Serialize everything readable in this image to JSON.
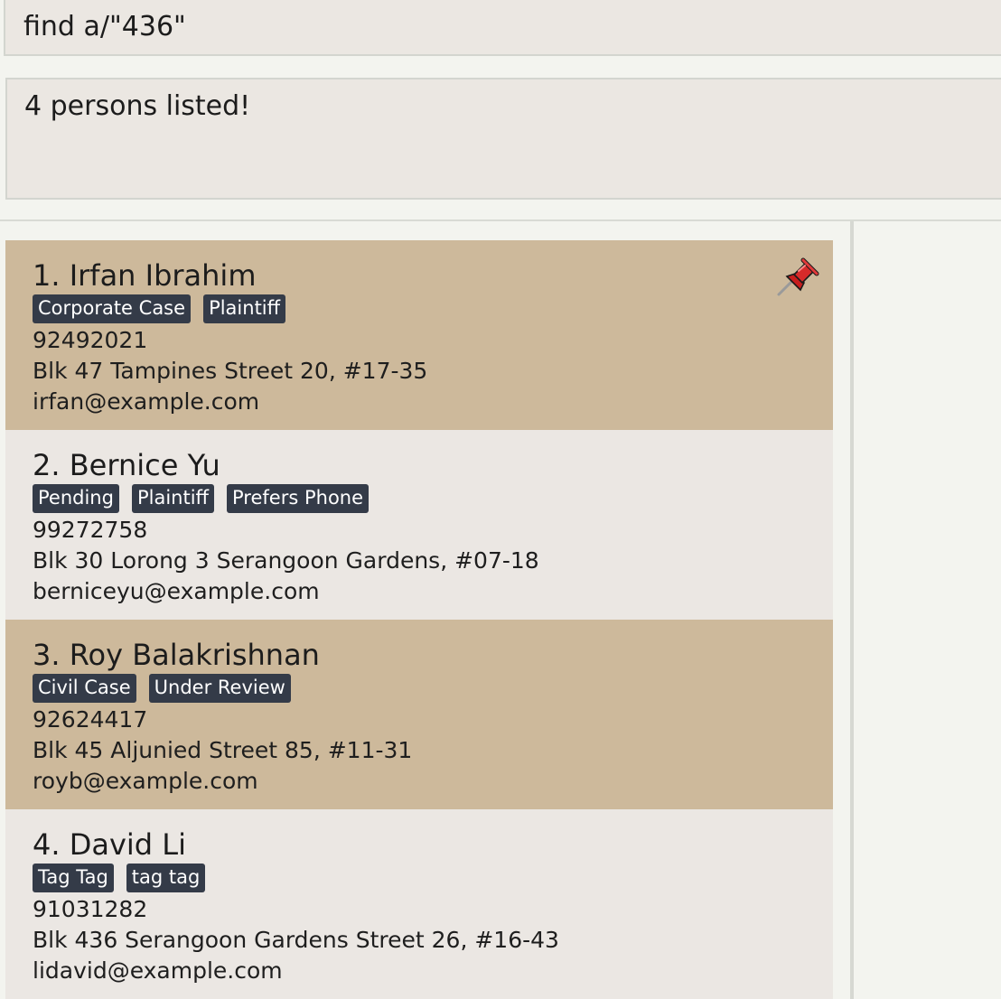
{
  "command_box": {
    "value": "find a/\"436\""
  },
  "result_display": {
    "text": "4 persons listed!"
  },
  "persons": [
    {
      "name": "1. Irfan Ibrahim",
      "tags": [
        "Corporate Case",
        "Plaintiff"
      ],
      "phone": "92492021",
      "address": "Blk 47 Tampines Street 20, #17-35",
      "email": "irfan@example.com",
      "pinned": true
    },
    {
      "name": "2. Bernice Yu",
      "tags": [
        "Pending",
        "Plaintiff",
        "Prefers Phone"
      ],
      "phone": "99272758",
      "address": "Blk 30 Lorong 3 Serangoon Gardens, #07-18",
      "email": "berniceyu@example.com",
      "pinned": false
    },
    {
      "name": "3. Roy Balakrishnan",
      "tags": [
        "Civil Case",
        "Under Review"
      ],
      "phone": "92624417",
      "address": "Blk 45 Aljunied Street 85, #11-31",
      "email": "royb@example.com",
      "pinned": false
    },
    {
      "name": "4. David Li",
      "tags": [
        "Tag Tag",
        "tag tag"
      ],
      "phone": "91031282",
      "address": "Blk 436 Serangoon Gardens Street 26, #16-43",
      "email": "lidavid@example.com",
      "pinned": false
    }
  ],
  "icons": {
    "pin": "pushpin-icon"
  },
  "colors": {
    "card_odd": "#cdb99b",
    "card_even": "#ebe7e3",
    "tag_bg": "#343b48"
  }
}
